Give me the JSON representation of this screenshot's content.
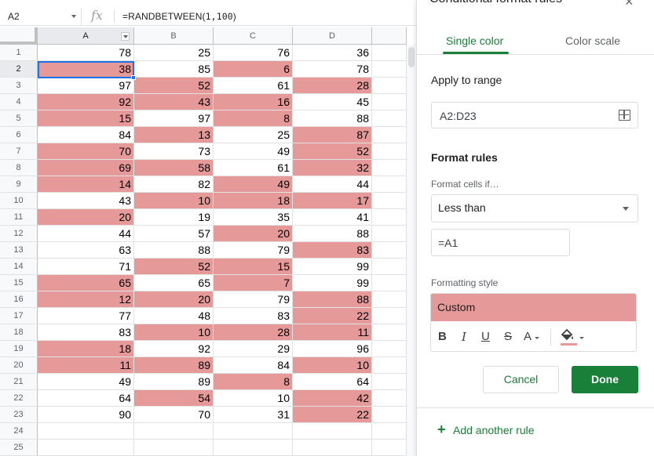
{
  "formula_bar": {
    "name_box": "A2",
    "fx_icon": "fx",
    "formula_prefix": "=RANDBETWEEN(",
    "formula_args": "1,100",
    "formula_suffix": ")"
  },
  "sheet": {
    "columns": [
      "A",
      "B",
      "C",
      "D"
    ],
    "rows": [
      {
        "n": "1",
        "cells": [
          "78",
          "25",
          "76",
          "36"
        ],
        "hl": [
          false,
          false,
          false,
          false
        ]
      },
      {
        "n": "2",
        "cells": [
          "38",
          "85",
          "6",
          "78"
        ],
        "hl": [
          true,
          false,
          true,
          false
        ]
      },
      {
        "n": "3",
        "cells": [
          "97",
          "52",
          "61",
          "28"
        ],
        "hl": [
          false,
          true,
          false,
          true
        ]
      },
      {
        "n": "4",
        "cells": [
          "92",
          "43",
          "16",
          "45"
        ],
        "hl": [
          true,
          true,
          true,
          false
        ]
      },
      {
        "n": "5",
        "cells": [
          "15",
          "97",
          "8",
          "88"
        ],
        "hl": [
          true,
          false,
          true,
          false
        ]
      },
      {
        "n": "6",
        "cells": [
          "84",
          "13",
          "25",
          "87"
        ],
        "hl": [
          false,
          true,
          false,
          true
        ]
      },
      {
        "n": "7",
        "cells": [
          "70",
          "73",
          "49",
          "52"
        ],
        "hl": [
          true,
          false,
          false,
          true
        ]
      },
      {
        "n": "8",
        "cells": [
          "69",
          "58",
          "61",
          "32"
        ],
        "hl": [
          true,
          true,
          false,
          true
        ]
      },
      {
        "n": "9",
        "cells": [
          "14",
          "82",
          "49",
          "44"
        ],
        "hl": [
          true,
          false,
          true,
          false
        ]
      },
      {
        "n": "10",
        "cells": [
          "43",
          "10",
          "18",
          "17"
        ],
        "hl": [
          false,
          true,
          true,
          true
        ]
      },
      {
        "n": "11",
        "cells": [
          "20",
          "19",
          "35",
          "41"
        ],
        "hl": [
          true,
          false,
          false,
          false
        ]
      },
      {
        "n": "12",
        "cells": [
          "44",
          "57",
          "20",
          "88"
        ],
        "hl": [
          false,
          false,
          true,
          false
        ]
      },
      {
        "n": "13",
        "cells": [
          "63",
          "88",
          "79",
          "83"
        ],
        "hl": [
          false,
          false,
          false,
          true
        ]
      },
      {
        "n": "14",
        "cells": [
          "71",
          "52",
          "15",
          "99"
        ],
        "hl": [
          false,
          true,
          true,
          false
        ]
      },
      {
        "n": "15",
        "cells": [
          "65",
          "65",
          "7",
          "99"
        ],
        "hl": [
          true,
          false,
          true,
          false
        ]
      },
      {
        "n": "16",
        "cells": [
          "12",
          "20",
          "79",
          "88"
        ],
        "hl": [
          true,
          true,
          false,
          true
        ]
      },
      {
        "n": "17",
        "cells": [
          "77",
          "48",
          "83",
          "22"
        ],
        "hl": [
          false,
          false,
          false,
          true
        ]
      },
      {
        "n": "18",
        "cells": [
          "83",
          "10",
          "28",
          "11"
        ],
        "hl": [
          false,
          true,
          true,
          true
        ]
      },
      {
        "n": "19",
        "cells": [
          "18",
          "92",
          "29",
          "96"
        ],
        "hl": [
          true,
          false,
          false,
          false
        ]
      },
      {
        "n": "20",
        "cells": [
          "11",
          "89",
          "84",
          "10"
        ],
        "hl": [
          true,
          true,
          false,
          true
        ]
      },
      {
        "n": "21",
        "cells": [
          "49",
          "89",
          "8",
          "64"
        ],
        "hl": [
          false,
          false,
          true,
          false
        ]
      },
      {
        "n": "22",
        "cells": [
          "64",
          "54",
          "10",
          "42"
        ],
        "hl": [
          false,
          true,
          false,
          true
        ]
      },
      {
        "n": "23",
        "cells": [
          "90",
          "70",
          "31",
          "22"
        ],
        "hl": [
          false,
          false,
          false,
          true
        ]
      },
      {
        "n": "24",
        "cells": [
          "",
          "",
          "",
          ""
        ],
        "hl": [
          false,
          false,
          false,
          false
        ]
      },
      {
        "n": "25",
        "cells": [
          "",
          "",
          "",
          ""
        ],
        "hl": [
          false,
          false,
          false,
          false
        ]
      }
    ],
    "highlight_color": "#e59999",
    "selection_color": "#1a73e8"
  },
  "panel": {
    "title": "Conditional format rules",
    "close_icon": "×",
    "tabs": {
      "single": "Single color",
      "scale": "Color scale"
    },
    "apply_label": "Apply to range",
    "range_value": "A2:D23",
    "format_rules_label": "Format rules",
    "format_cells_if_label": "Format cells if…",
    "condition": "Less than",
    "value": "=A1",
    "formatting_style_label": "Formatting style",
    "style_preview_text": "Custom",
    "toolbar": {
      "bold": "B",
      "italic": "I",
      "underline": "U",
      "strike": "S",
      "text_color": "A"
    },
    "cancel_label": "Cancel",
    "done_label": "Done",
    "add_rule_label": "Add another rule",
    "add_icon": "+",
    "accent_color": "#188038"
  }
}
